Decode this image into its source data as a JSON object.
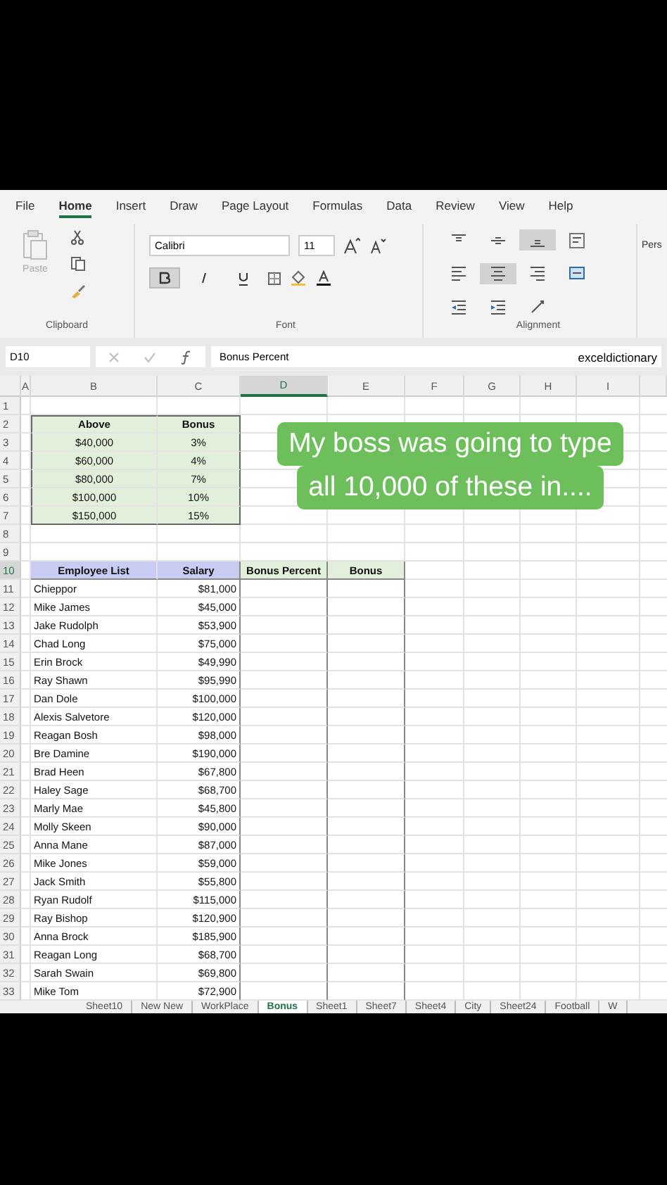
{
  "ribbon": {
    "tabs": [
      {
        "label": "File",
        "selected": false
      },
      {
        "label": "Home",
        "selected": true
      },
      {
        "label": "Insert",
        "selected": false
      },
      {
        "label": "Draw",
        "selected": false
      },
      {
        "label": "Page Layout",
        "selected": false
      },
      {
        "label": "Formulas",
        "selected": false
      },
      {
        "label": "Data",
        "selected": false
      },
      {
        "label": "Review",
        "selected": false
      },
      {
        "label": "View",
        "selected": false
      },
      {
        "label": "Help",
        "selected": false
      }
    ],
    "clipboard": {
      "paste_label": "Paste",
      "group_label": "Clipboard"
    },
    "font": {
      "name": "Calibri",
      "size": "11",
      "bold": true,
      "italic": false,
      "underline": false,
      "group_label": "Font"
    },
    "alignment": {
      "group_label": "Alignment",
      "buttons": [
        {
          "kind": "top",
          "selected": false
        },
        {
          "kind": "middle",
          "selected": false
        },
        {
          "kind": "bottom",
          "selected": true
        },
        {
          "kind": "wrap",
          "selected": false
        },
        {
          "kind": "left",
          "selected": false
        },
        {
          "kind": "center",
          "selected": true
        },
        {
          "kind": "right",
          "selected": false
        },
        {
          "kind": "merge",
          "selected": false
        },
        {
          "kind": "outdent",
          "selected": false
        },
        {
          "kind": "indent",
          "selected": false
        },
        {
          "kind": "orientation",
          "selected": false
        }
      ]
    },
    "number_format": "Pers"
  },
  "formula_bar": {
    "name_box": "D10",
    "formula": "Bonus Percent"
  },
  "handle": "exceldictionary",
  "sheet": {
    "columns": [
      {
        "label": "A",
        "selected": false
      },
      {
        "label": "B",
        "selected": false
      },
      {
        "label": "C",
        "selected": false
      },
      {
        "label": "D",
        "selected": true
      },
      {
        "label": "E",
        "selected": false
      },
      {
        "label": "F",
        "selected": false
      },
      {
        "label": "G",
        "selected": false
      },
      {
        "label": "H",
        "selected": false
      },
      {
        "label": "I",
        "selected": false
      }
    ],
    "rows": [
      {
        "number": "1",
        "selected": false,
        "kind": "blank",
        "cells": {}
      },
      {
        "number": "2",
        "selected": false,
        "kind": "lookup-header",
        "cells": {
          "B": "Above",
          "C": "Bonus"
        }
      },
      {
        "number": "3",
        "selected": false,
        "kind": "lookup",
        "cells": {
          "B": "$40,000",
          "C": "3%"
        }
      },
      {
        "number": "4",
        "selected": false,
        "kind": "lookup",
        "cells": {
          "B": "$60,000",
          "C": "4%"
        }
      },
      {
        "number": "5",
        "selected": false,
        "kind": "lookup",
        "cells": {
          "B": "$80,000",
          "C": "7%"
        }
      },
      {
        "number": "6",
        "selected": false,
        "kind": "lookup",
        "cells": {
          "B": "$100,000",
          "C": "10%"
        }
      },
      {
        "number": "7",
        "selected": false,
        "kind": "lookup-end",
        "cells": {
          "B": "$150,000",
          "C": "15%"
        }
      },
      {
        "number": "8",
        "selected": false,
        "kind": "blank",
        "cells": {}
      },
      {
        "number": "9",
        "selected": false,
        "kind": "blank",
        "cells": {}
      },
      {
        "number": "10",
        "selected": true,
        "kind": "list-header",
        "cells": {
          "B": "Employee List",
          "C": "Salary",
          "D": "Bonus Percent",
          "E": "Bonus"
        }
      },
      {
        "number": "11",
        "selected": false,
        "kind": "list",
        "cells": {
          "B": "Chieppor",
          "C": "$81,000"
        }
      },
      {
        "number": "12",
        "selected": false,
        "kind": "list",
        "cells": {
          "B": "Mike James",
          "C": "$45,000"
        }
      },
      {
        "number": "13",
        "selected": false,
        "kind": "list",
        "cells": {
          "B": "Jake Rudolph",
          "C": "$53,900"
        }
      },
      {
        "number": "14",
        "selected": false,
        "kind": "list",
        "cells": {
          "B": "Chad Long",
          "C": "$75,000"
        }
      },
      {
        "number": "15",
        "selected": false,
        "kind": "list",
        "cells": {
          "B": "Erin Brock",
          "C": "$49,990"
        }
      },
      {
        "number": "16",
        "selected": false,
        "kind": "list",
        "cells": {
          "B": "Ray Shawn",
          "C": "$95,990"
        }
      },
      {
        "number": "17",
        "selected": false,
        "kind": "list",
        "cells": {
          "B": "Dan Dole",
          "C": "$100,000"
        }
      },
      {
        "number": "18",
        "selected": false,
        "kind": "list",
        "cells": {
          "B": "Alexis Salvetore",
          "C": "$120,000"
        }
      },
      {
        "number": "19",
        "selected": false,
        "kind": "list",
        "cells": {
          "B": "Reagan Bosh",
          "C": "$98,000"
        }
      },
      {
        "number": "20",
        "selected": false,
        "kind": "list",
        "cells": {
          "B": "Bre Damine",
          "C": "$190,000"
        }
      },
      {
        "number": "21",
        "selected": false,
        "kind": "list",
        "cells": {
          "B": "Brad Heen",
          "C": "$67,800"
        }
      },
      {
        "number": "22",
        "selected": false,
        "kind": "list",
        "cells": {
          "B": "Haley Sage",
          "C": "$68,700"
        }
      },
      {
        "number": "23",
        "selected": false,
        "kind": "list",
        "cells": {
          "B": "Marly Mae",
          "C": "$45,800"
        }
      },
      {
        "number": "24",
        "selected": false,
        "kind": "list",
        "cells": {
          "B": "Molly Skeen",
          "C": "$90,000"
        }
      },
      {
        "number": "25",
        "selected": false,
        "kind": "list",
        "cells": {
          "B": "Anna Mane",
          "C": "$87,000"
        }
      },
      {
        "number": "26",
        "selected": false,
        "kind": "list",
        "cells": {
          "B": "Mike Jones",
          "C": "$59,000"
        }
      },
      {
        "number": "27",
        "selected": false,
        "kind": "list",
        "cells": {
          "B": "Jack Smith",
          "C": "$55,800"
        }
      },
      {
        "number": "28",
        "selected": false,
        "kind": "list",
        "cells": {
          "B": "Ryan Rudolf",
          "C": "$115,000"
        }
      },
      {
        "number": "29",
        "selected": false,
        "kind": "list",
        "cells": {
          "B": "Ray Bishop",
          "C": "$120,900"
        }
      },
      {
        "number": "30",
        "selected": false,
        "kind": "list",
        "cells": {
          "B": "Anna Brock",
          "C": "$185,900"
        }
      },
      {
        "number": "31",
        "selected": false,
        "kind": "list",
        "cells": {
          "B": "Reagan Long",
          "C": "$68,700"
        }
      },
      {
        "number": "32",
        "selected": false,
        "kind": "list",
        "cells": {
          "B": "Sarah Swain",
          "C": "$69,800"
        }
      },
      {
        "number": "33",
        "selected": false,
        "kind": "list",
        "cells": {
          "B": "Mike Tom",
          "C": "$72,900"
        }
      }
    ]
  },
  "caption": {
    "lines": [
      "My boss was going to type",
      "all 10,000 of these in...."
    ]
  },
  "sheet_tabs": [
    {
      "label": "Sheet10",
      "selected": false
    },
    {
      "label": "New New",
      "selected": false
    },
    {
      "label": "WorkPlace",
      "selected": false
    },
    {
      "label": "Bonus",
      "selected": true
    },
    {
      "label": "Sheet1",
      "selected": false
    },
    {
      "label": "Sheet7",
      "selected": false
    },
    {
      "label": "Sheet4",
      "selected": false
    },
    {
      "label": "City",
      "selected": false
    },
    {
      "label": "Sheet24",
      "selected": false
    },
    {
      "label": "Football",
      "selected": false
    },
    {
      "label": "W",
      "selected": false
    }
  ]
}
